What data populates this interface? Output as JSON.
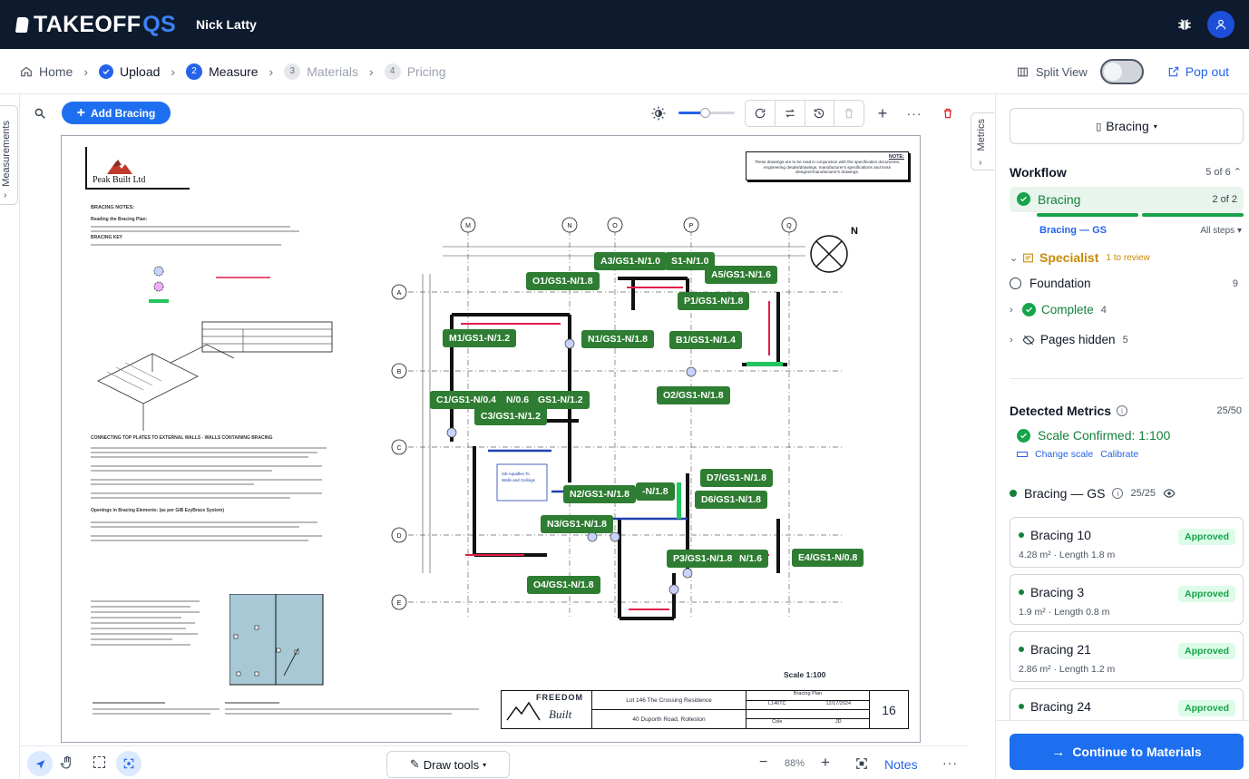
{
  "app": {
    "logo_main": "TAKEOFF",
    "logo_accent": "QS",
    "user": "Nick Latty"
  },
  "breadcrumb": {
    "home": "Home",
    "steps": [
      {
        "num": "",
        "label": "Upload",
        "state": "done"
      },
      {
        "num": "2",
        "label": "Measure",
        "state": "active"
      },
      {
        "num": "3",
        "label": "Materials",
        "state": "pending"
      },
      {
        "num": "4",
        "label": "Pricing",
        "state": "pending"
      }
    ],
    "split_view": "Split View",
    "pop_out": "Pop out"
  },
  "left_tab": "Measurements",
  "right_tab": "Metrics",
  "toolbar": {
    "add_bracing": "Add Bracing"
  },
  "bottom": {
    "draw_tools": "Draw tools",
    "zoom": "88%",
    "notes": "Notes"
  },
  "drawing": {
    "company": "Peak Built Ltd",
    "note_title": "NOTE:",
    "note_text": "These drawings are to be read in conjunction with the specification documents, engineering details/drawings, manufacturer's specifications and truss designer/manufacturer's drawings.",
    "bracing_notes_title": "BRACING NOTES:",
    "reading_plan": "Reading the Bracing Plan:",
    "bracing_key": "BRACING KEY",
    "connecting_title": "CONNECTING TOP PLATES TO EXTERNAL WALLS - WALLS CONTAINING BRACING",
    "openings_title": "Openings in Bracing Elements: (as per GIB EzyBrace System)",
    "scale_text": "Scale 1:100",
    "title_block": {
      "brand_top": "FREEDOM",
      "brand_bottom": "Built",
      "project": "Lot 146 The Crossing Residence",
      "address": "40 Duporth Road, Rolleston",
      "sheet_title": "Bracing Plan",
      "code": "L146TC",
      "date": "12/17/2024",
      "drawn": "Cole",
      "checked": "JD",
      "sheet_no": "16"
    },
    "grid_cols": [
      "M",
      "N",
      "O",
      "P",
      "Q"
    ],
    "grid_rows": [
      "A",
      "B",
      "C",
      "D",
      "E"
    ],
    "tags": [
      "A3/GS1-N/1.0",
      "S1-N/1.0",
      "O1/GS1-N/1.8",
      "A5/GS1-N/1.6",
      "P1/GS1-N/1.8",
      "M1/GS1-N/1.2",
      "N1/GS1-N/1.8",
      "B1/GS1-N/1.4",
      "O2/GS1-N/1.8",
      "C1/GS1-N/0.4",
      "N/0.6",
      "GS1-N/1.2",
      "C3/GS1-N/1.2",
      "D7/GS1-N/1.8",
      "N2/GS1-N/1.8",
      "-N/1.8",
      "D6/GS1-N/1.8",
      "N3/GS1-N/1.8",
      "P3/GS1-N/1.8",
      "N/1.6",
      "E4/GS1-N/0.8",
      "O4/GS1-N/1.8"
    ]
  },
  "panel": {
    "dropdown": "Bracing",
    "workflow_title": "Workflow",
    "workflow_count": "5 of 6",
    "active_step": "Bracing",
    "active_count": "2 of 2",
    "sub_label": "Bracing — GS",
    "all_steps": "All steps",
    "specialist": "Specialist",
    "specialist_review": "1 to review",
    "foundation": "Foundation",
    "foundation_count": "9",
    "complete": "Complete",
    "complete_count": "4",
    "pages_hidden": "Pages hidden",
    "pages_hidden_count": "5",
    "detected_title": "Detected Metrics",
    "detected_count": "25/50",
    "scale_confirmed": "Scale Confirmed: 1:100",
    "change_scale": "Change scale",
    "calibrate": "Calibrate",
    "group_name": "Bracing — GS",
    "group_count": "25/25",
    "cards": [
      {
        "name": "Bracing 10",
        "meta": "4.28 m² · Length 1.8 m",
        "status": "Approved"
      },
      {
        "name": "Bracing 3",
        "meta": "1.9 m² · Length 0.8 m",
        "status": "Approved"
      },
      {
        "name": "Bracing 21",
        "meta": "2.86 m² · Length 1.2 m",
        "status": "Approved"
      },
      {
        "name": "Bracing 24",
        "meta": "",
        "status": "Approved"
      }
    ],
    "continue": "Continue to Materials"
  },
  "colors": {
    "topbar": "#0e1b2e",
    "accent": "#1d6ff0",
    "tag_green": "#2e7d32",
    "success": "#16a34a"
  }
}
